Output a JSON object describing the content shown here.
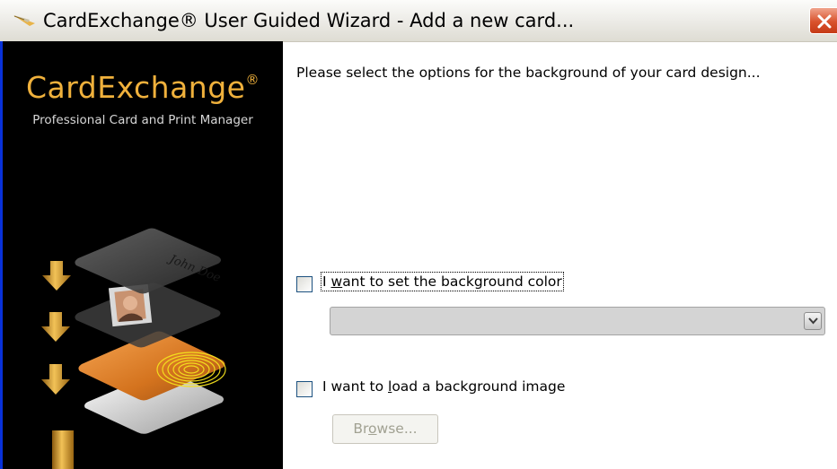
{
  "window": {
    "title": "CardExchange® User Guided Wizard - Add a new card...",
    "title_icon": "cardexchange-app-icon",
    "close_icon": "close-icon"
  },
  "sidebar": {
    "logo": "CardExchange",
    "logo_mark": "®",
    "tagline": "Professional Card and Print Manager",
    "card_name_text": "John Doe"
  },
  "main": {
    "prompt": "Please select the options for the background of your card design...",
    "option_color": {
      "label_pre": "I ",
      "label_accel": "w",
      "label_post": "ant to set the background color",
      "checked": false,
      "select_value": ""
    },
    "option_image": {
      "label_pre": "I want to ",
      "label_accel": "l",
      "label_post": "oad a background image",
      "checked": false
    },
    "browse": {
      "label_pre": "Br",
      "label_accel": "o",
      "label_post": "wse...",
      "enabled": false
    }
  },
  "colors": {
    "title_bar": "#ebeae5",
    "sidebar_bg": "#000000",
    "logo": "#f0b13c",
    "arrows": "#e6a928",
    "close_button": "#d9522c"
  }
}
